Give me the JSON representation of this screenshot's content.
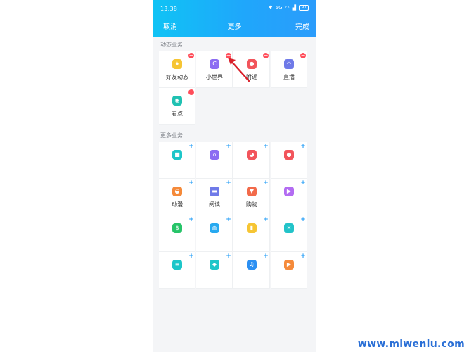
{
  "status_bar": {
    "time": "13:38",
    "icons": [
      "bluetooth-icon",
      "data-speed-icon",
      "wifi-icon",
      "signal-icon",
      "battery-icon"
    ],
    "speed": "5G",
    "battery": "90"
  },
  "nav": {
    "cancel": "取消",
    "title": "更多",
    "done": "完成"
  },
  "sections": {
    "dynamic": {
      "label": "动态业务",
      "items": [
        {
          "label": "好友动态",
          "icon": "star-icon",
          "color": "#f6c533",
          "glyph": "★"
        },
        {
          "label": "小世界",
          "icon": "planet-icon",
          "color": "#8c6cf2",
          "glyph": "C"
        },
        {
          "label": "附近",
          "icon": "location-pin-icon",
          "color": "#f2545b",
          "glyph": "●"
        },
        {
          "label": "直播",
          "icon": "live-icon",
          "color": "#6f7ae8",
          "glyph": "◠"
        },
        {
          "label": "看点",
          "icon": "eye-icon",
          "color": "#20c1b2",
          "glyph": "◉"
        }
      ]
    },
    "more": {
      "label": "更多业务",
      "items": [
        {
          "label": "",
          "icon": "gamepad-icon",
          "color": "#1dc6c9",
          "glyph": "■"
        },
        {
          "label": "",
          "icon": "home-icon",
          "color": "#8c6cf2",
          "glyph": "⌂"
        },
        {
          "label": "",
          "icon": "pie-icon",
          "color": "#f2545b",
          "glyph": "◕"
        },
        {
          "label": "",
          "icon": "user-icon",
          "color": "#f2545b",
          "glyph": "●"
        },
        {
          "label": "动漫",
          "icon": "comic-icon",
          "color": "#f58a3a",
          "glyph": "◒"
        },
        {
          "label": "阅读",
          "icon": "book-icon",
          "color": "#6f7ae8",
          "glyph": "▬"
        },
        {
          "label": "购物",
          "icon": "shirt-icon",
          "color": "#f26a4a",
          "glyph": "▼"
        },
        {
          "label": "",
          "icon": "play-icon",
          "color": "#b36cf2",
          "glyph": "▶"
        },
        {
          "label": "",
          "icon": "coin-icon",
          "color": "#27c469",
          "glyph": "$"
        },
        {
          "label": "",
          "icon": "globe-icon",
          "color": "#27a9f0",
          "glyph": "◍"
        },
        {
          "label": "",
          "icon": "finger-icon",
          "color": "#f6c533",
          "glyph": "▮"
        },
        {
          "label": "",
          "icon": "tools-icon",
          "color": "#22c3c9",
          "glyph": "✕"
        },
        {
          "label": "",
          "icon": "list-icon",
          "color": "#1dc6c9",
          "glyph": "≡"
        },
        {
          "label": "",
          "icon": "shield-icon",
          "color": "#1dc6c9",
          "glyph": "◆"
        },
        {
          "label": "",
          "icon": "music-icon",
          "color": "#2b8ff2",
          "glyph": "♫"
        },
        {
          "label": "",
          "icon": "video-icon",
          "color": "#f58a3a",
          "glyph": "▶"
        }
      ]
    }
  },
  "annotation": {
    "arrow_color": "#d9202a"
  },
  "watermark": "www.mlwenlu.com"
}
